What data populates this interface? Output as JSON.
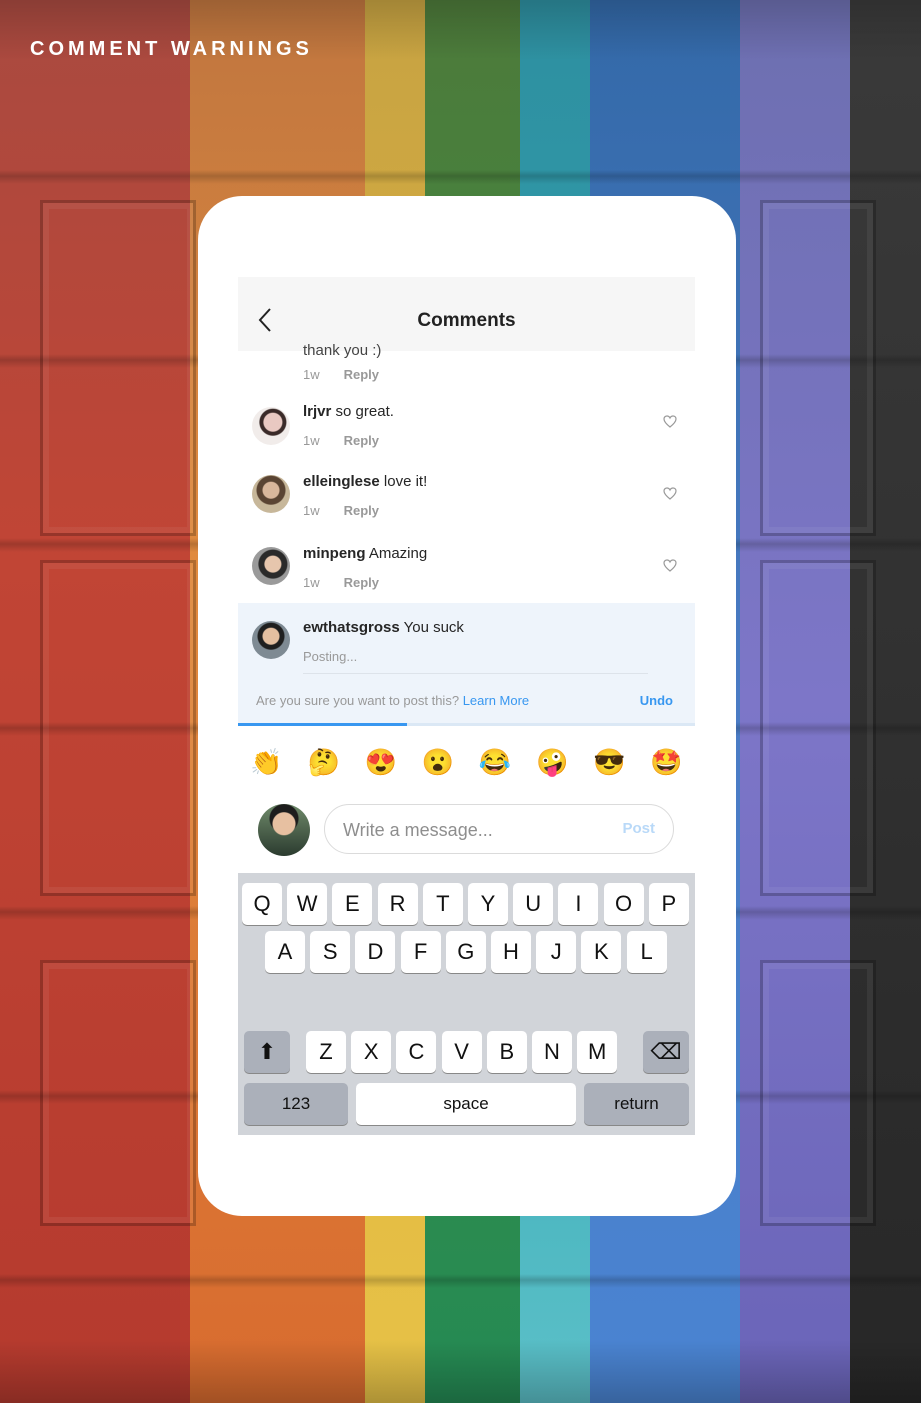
{
  "header": {
    "label": "COMMENT WARNINGS"
  },
  "nav": {
    "title": "Comments",
    "back_icon": "chevron-left-icon"
  },
  "partial_comment": {
    "text": "thank you :)",
    "time": "1w",
    "reply": "Reply"
  },
  "comments": [
    {
      "user": "lrjvr",
      "text": "so great.",
      "time": "1w",
      "reply": "Reply"
    },
    {
      "user": "elleinglese",
      "text": "love it!",
      "time": "1w",
      "reply": "Reply"
    },
    {
      "user": "minpeng",
      "text": "Amazing",
      "time": "1w",
      "reply": "Reply"
    }
  ],
  "pending_comment": {
    "user": "ewthatsgross",
    "text": "You suck",
    "status": "Posting..."
  },
  "warning": {
    "text": "Are you sure you want to post this?",
    "link": "Learn More",
    "undo": "Undo",
    "progress": 0.37
  },
  "emojis": [
    "👏",
    "🤔",
    "😍",
    "😮",
    "😂",
    "🤪",
    "😎",
    "🤩"
  ],
  "compose": {
    "placeholder": "Write a message...",
    "post_label": "Post"
  },
  "keyboard": {
    "row1": [
      "Q",
      "W",
      "E",
      "R",
      "T",
      "Y",
      "U",
      "I",
      "O",
      "P"
    ],
    "row2": [
      "A",
      "S",
      "D",
      "F",
      "G",
      "H",
      "J",
      "K",
      "L"
    ],
    "row3": [
      "Z",
      "X",
      "C",
      "V",
      "B",
      "N",
      "M"
    ],
    "shift": "⬆",
    "backspace": "⌫",
    "numbers": "123",
    "space": "space",
    "return": "return"
  },
  "colors": {
    "accent": "#3897f0",
    "pending_bg": "#eef4fb"
  }
}
